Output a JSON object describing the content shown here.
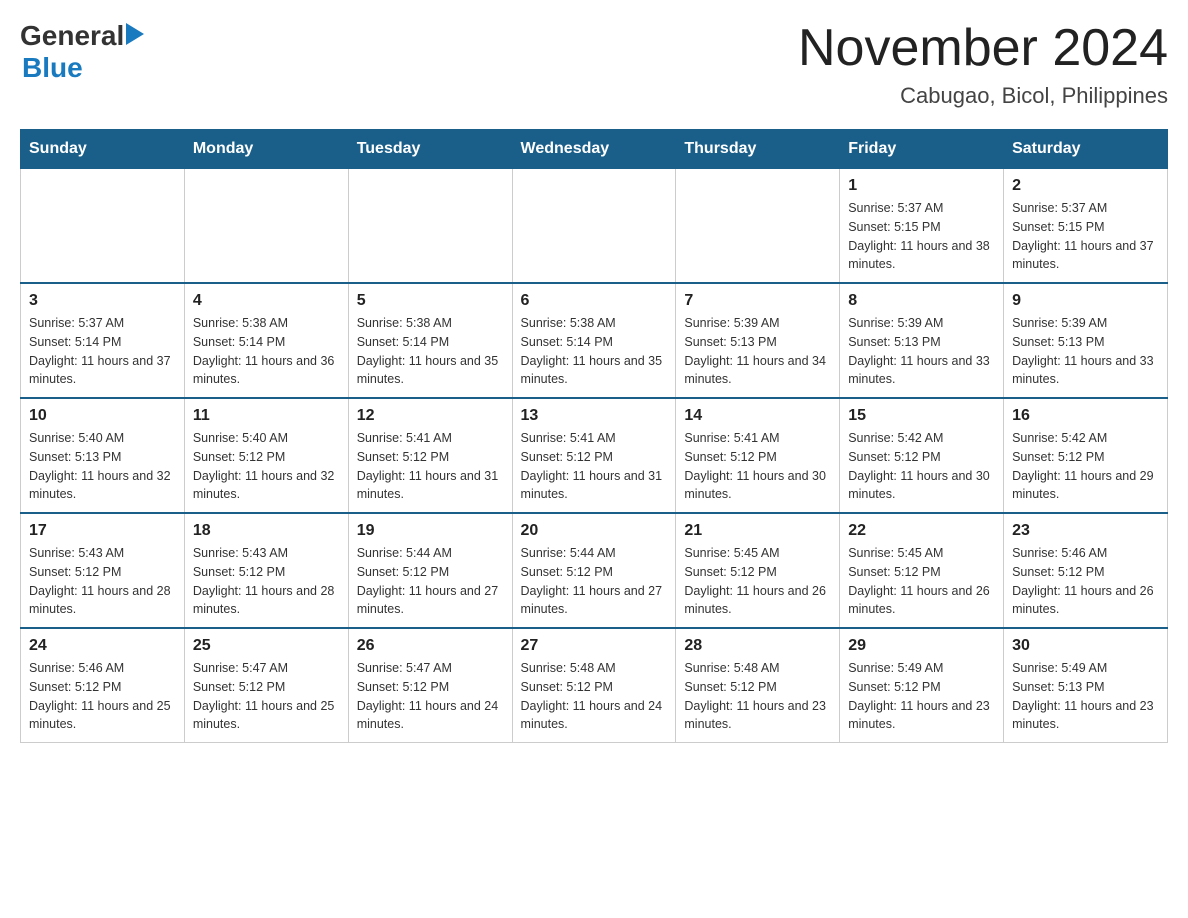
{
  "header": {
    "logo": {
      "general": "General",
      "arrow_symbol": "▶",
      "blue": "Blue"
    },
    "title": "November 2024",
    "subtitle": "Cabugao, Bicol, Philippines"
  },
  "calendar": {
    "days_of_week": [
      "Sunday",
      "Monday",
      "Tuesday",
      "Wednesday",
      "Thursday",
      "Friday",
      "Saturday"
    ],
    "weeks": [
      [
        {
          "day": "",
          "sunrise": "",
          "sunset": "",
          "daylight": ""
        },
        {
          "day": "",
          "sunrise": "",
          "sunset": "",
          "daylight": ""
        },
        {
          "day": "",
          "sunrise": "",
          "sunset": "",
          "daylight": ""
        },
        {
          "day": "",
          "sunrise": "",
          "sunset": "",
          "daylight": ""
        },
        {
          "day": "",
          "sunrise": "",
          "sunset": "",
          "daylight": ""
        },
        {
          "day": "1",
          "sunrise": "Sunrise: 5:37 AM",
          "sunset": "Sunset: 5:15 PM",
          "daylight": "Daylight: 11 hours and 38 minutes."
        },
        {
          "day": "2",
          "sunrise": "Sunrise: 5:37 AM",
          "sunset": "Sunset: 5:15 PM",
          "daylight": "Daylight: 11 hours and 37 minutes."
        }
      ],
      [
        {
          "day": "3",
          "sunrise": "Sunrise: 5:37 AM",
          "sunset": "Sunset: 5:14 PM",
          "daylight": "Daylight: 11 hours and 37 minutes."
        },
        {
          "day": "4",
          "sunrise": "Sunrise: 5:38 AM",
          "sunset": "Sunset: 5:14 PM",
          "daylight": "Daylight: 11 hours and 36 minutes."
        },
        {
          "day": "5",
          "sunrise": "Sunrise: 5:38 AM",
          "sunset": "Sunset: 5:14 PM",
          "daylight": "Daylight: 11 hours and 35 minutes."
        },
        {
          "day": "6",
          "sunrise": "Sunrise: 5:38 AM",
          "sunset": "Sunset: 5:14 PM",
          "daylight": "Daylight: 11 hours and 35 minutes."
        },
        {
          "day": "7",
          "sunrise": "Sunrise: 5:39 AM",
          "sunset": "Sunset: 5:13 PM",
          "daylight": "Daylight: 11 hours and 34 minutes."
        },
        {
          "day": "8",
          "sunrise": "Sunrise: 5:39 AM",
          "sunset": "Sunset: 5:13 PM",
          "daylight": "Daylight: 11 hours and 33 minutes."
        },
        {
          "day": "9",
          "sunrise": "Sunrise: 5:39 AM",
          "sunset": "Sunset: 5:13 PM",
          "daylight": "Daylight: 11 hours and 33 minutes."
        }
      ],
      [
        {
          "day": "10",
          "sunrise": "Sunrise: 5:40 AM",
          "sunset": "Sunset: 5:13 PM",
          "daylight": "Daylight: 11 hours and 32 minutes."
        },
        {
          "day": "11",
          "sunrise": "Sunrise: 5:40 AM",
          "sunset": "Sunset: 5:12 PM",
          "daylight": "Daylight: 11 hours and 32 minutes."
        },
        {
          "day": "12",
          "sunrise": "Sunrise: 5:41 AM",
          "sunset": "Sunset: 5:12 PM",
          "daylight": "Daylight: 11 hours and 31 minutes."
        },
        {
          "day": "13",
          "sunrise": "Sunrise: 5:41 AM",
          "sunset": "Sunset: 5:12 PM",
          "daylight": "Daylight: 11 hours and 31 minutes."
        },
        {
          "day": "14",
          "sunrise": "Sunrise: 5:41 AM",
          "sunset": "Sunset: 5:12 PM",
          "daylight": "Daylight: 11 hours and 30 minutes."
        },
        {
          "day": "15",
          "sunrise": "Sunrise: 5:42 AM",
          "sunset": "Sunset: 5:12 PM",
          "daylight": "Daylight: 11 hours and 30 minutes."
        },
        {
          "day": "16",
          "sunrise": "Sunrise: 5:42 AM",
          "sunset": "Sunset: 5:12 PM",
          "daylight": "Daylight: 11 hours and 29 minutes."
        }
      ],
      [
        {
          "day": "17",
          "sunrise": "Sunrise: 5:43 AM",
          "sunset": "Sunset: 5:12 PM",
          "daylight": "Daylight: 11 hours and 28 minutes."
        },
        {
          "day": "18",
          "sunrise": "Sunrise: 5:43 AM",
          "sunset": "Sunset: 5:12 PM",
          "daylight": "Daylight: 11 hours and 28 minutes."
        },
        {
          "day": "19",
          "sunrise": "Sunrise: 5:44 AM",
          "sunset": "Sunset: 5:12 PM",
          "daylight": "Daylight: 11 hours and 27 minutes."
        },
        {
          "day": "20",
          "sunrise": "Sunrise: 5:44 AM",
          "sunset": "Sunset: 5:12 PM",
          "daylight": "Daylight: 11 hours and 27 minutes."
        },
        {
          "day": "21",
          "sunrise": "Sunrise: 5:45 AM",
          "sunset": "Sunset: 5:12 PM",
          "daylight": "Daylight: 11 hours and 26 minutes."
        },
        {
          "day": "22",
          "sunrise": "Sunrise: 5:45 AM",
          "sunset": "Sunset: 5:12 PM",
          "daylight": "Daylight: 11 hours and 26 minutes."
        },
        {
          "day": "23",
          "sunrise": "Sunrise: 5:46 AM",
          "sunset": "Sunset: 5:12 PM",
          "daylight": "Daylight: 11 hours and 26 minutes."
        }
      ],
      [
        {
          "day": "24",
          "sunrise": "Sunrise: 5:46 AM",
          "sunset": "Sunset: 5:12 PM",
          "daylight": "Daylight: 11 hours and 25 minutes."
        },
        {
          "day": "25",
          "sunrise": "Sunrise: 5:47 AM",
          "sunset": "Sunset: 5:12 PM",
          "daylight": "Daylight: 11 hours and 25 minutes."
        },
        {
          "day": "26",
          "sunrise": "Sunrise: 5:47 AM",
          "sunset": "Sunset: 5:12 PM",
          "daylight": "Daylight: 11 hours and 24 minutes."
        },
        {
          "day": "27",
          "sunrise": "Sunrise: 5:48 AM",
          "sunset": "Sunset: 5:12 PM",
          "daylight": "Daylight: 11 hours and 24 minutes."
        },
        {
          "day": "28",
          "sunrise": "Sunrise: 5:48 AM",
          "sunset": "Sunset: 5:12 PM",
          "daylight": "Daylight: 11 hours and 23 minutes."
        },
        {
          "day": "29",
          "sunrise": "Sunrise: 5:49 AM",
          "sunset": "Sunset: 5:12 PM",
          "daylight": "Daylight: 11 hours and 23 minutes."
        },
        {
          "day": "30",
          "sunrise": "Sunrise: 5:49 AM",
          "sunset": "Sunset: 5:13 PM",
          "daylight": "Daylight: 11 hours and 23 minutes."
        }
      ]
    ]
  }
}
